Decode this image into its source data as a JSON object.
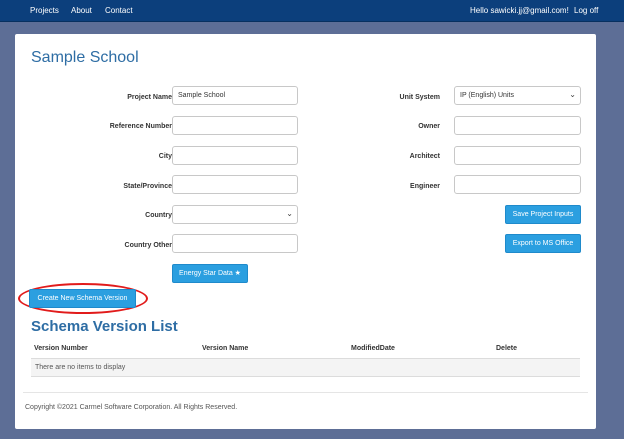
{
  "nav": {
    "projects": "Projects",
    "about": "About",
    "contact": "Contact",
    "greeting": "Hello sawicki.jj@gmail.com!",
    "logoff": "Log off"
  },
  "page": {
    "title": "Sample School"
  },
  "form": {
    "project_name": {
      "label": "Project Name",
      "value": "Sample School"
    },
    "reference_number": {
      "label": "Reference Number",
      "value": ""
    },
    "city": {
      "label": "City",
      "value": ""
    },
    "state": {
      "label": "State/Province",
      "value": ""
    },
    "country": {
      "label": "Country",
      "value": ""
    },
    "country_other": {
      "label": "Country Other",
      "value": ""
    },
    "unit_system": {
      "label": "Unit System",
      "value": "IP (English) Units"
    },
    "owner": {
      "label": "Owner",
      "value": ""
    },
    "architect": {
      "label": "Architect",
      "value": ""
    },
    "engineer": {
      "label": "Engineer",
      "value": ""
    }
  },
  "buttons": {
    "save": "Save Project Inputs",
    "export": "Export to MS Office",
    "energy_star": "Energy Star Data ★",
    "create_schema": "Create New Schema Version"
  },
  "schema": {
    "title": "Schema Version List",
    "columns": [
      "Version Number",
      "Version Name",
      "ModifiedDate",
      "Delete"
    ],
    "empty_text": "There are no items to display"
  },
  "footer": {
    "text": "Copyright ©2021 Carmel Software Corporation. All Rights Reserved."
  },
  "colors": {
    "navbar": "#0c3f7c",
    "button": "#2b9fe0",
    "title": "#2e6da4",
    "highlight": "#e11b1b",
    "background": "#5d6e96"
  }
}
